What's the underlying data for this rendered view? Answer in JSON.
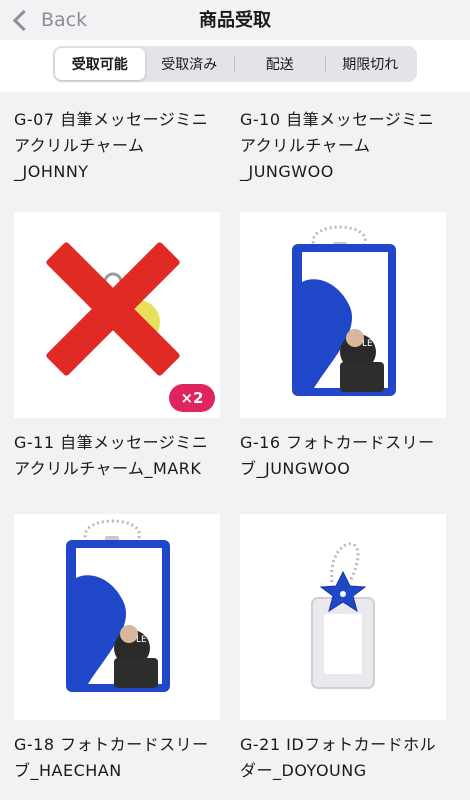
{
  "header": {
    "back_label": "Back",
    "title": "商品受取"
  },
  "tabs": [
    {
      "label": "受取可能",
      "active": true
    },
    {
      "label": "受取済み",
      "active": false
    },
    {
      "label": "配送",
      "active": false
    },
    {
      "label": "期限切れ",
      "active": false
    }
  ],
  "items": [
    {
      "line1": "G-07 自筆メッセージミニ",
      "line2": "アクリルチャーム",
      "line3": "_JOHNNY"
    },
    {
      "line1": "G-10 自筆メッセージミニ",
      "line2": "アクリルチャーム",
      "line3": "_JUNGWOO"
    },
    {
      "line1": "G-11 自筆メッセージミニ",
      "line2": "アクリルチャーム_MARK",
      "badge": "×2"
    },
    {
      "line1": "G-16 フォトカードスリー",
      "line2": "ブ_JUNGWOO"
    },
    {
      "line1": "G-18 フォトカードスリー",
      "line2": "ブ_HAECHAN"
    },
    {
      "line1": "G-21 IDフォトカードホル",
      "line2": "ダー_DOYOUNG"
    }
  ],
  "colors": {
    "accent_blue": "#1f47c7",
    "badge_pink": "#e0245e",
    "cross_red": "#e02a23"
  },
  "icons": {
    "back": "chevron-left-icon"
  }
}
